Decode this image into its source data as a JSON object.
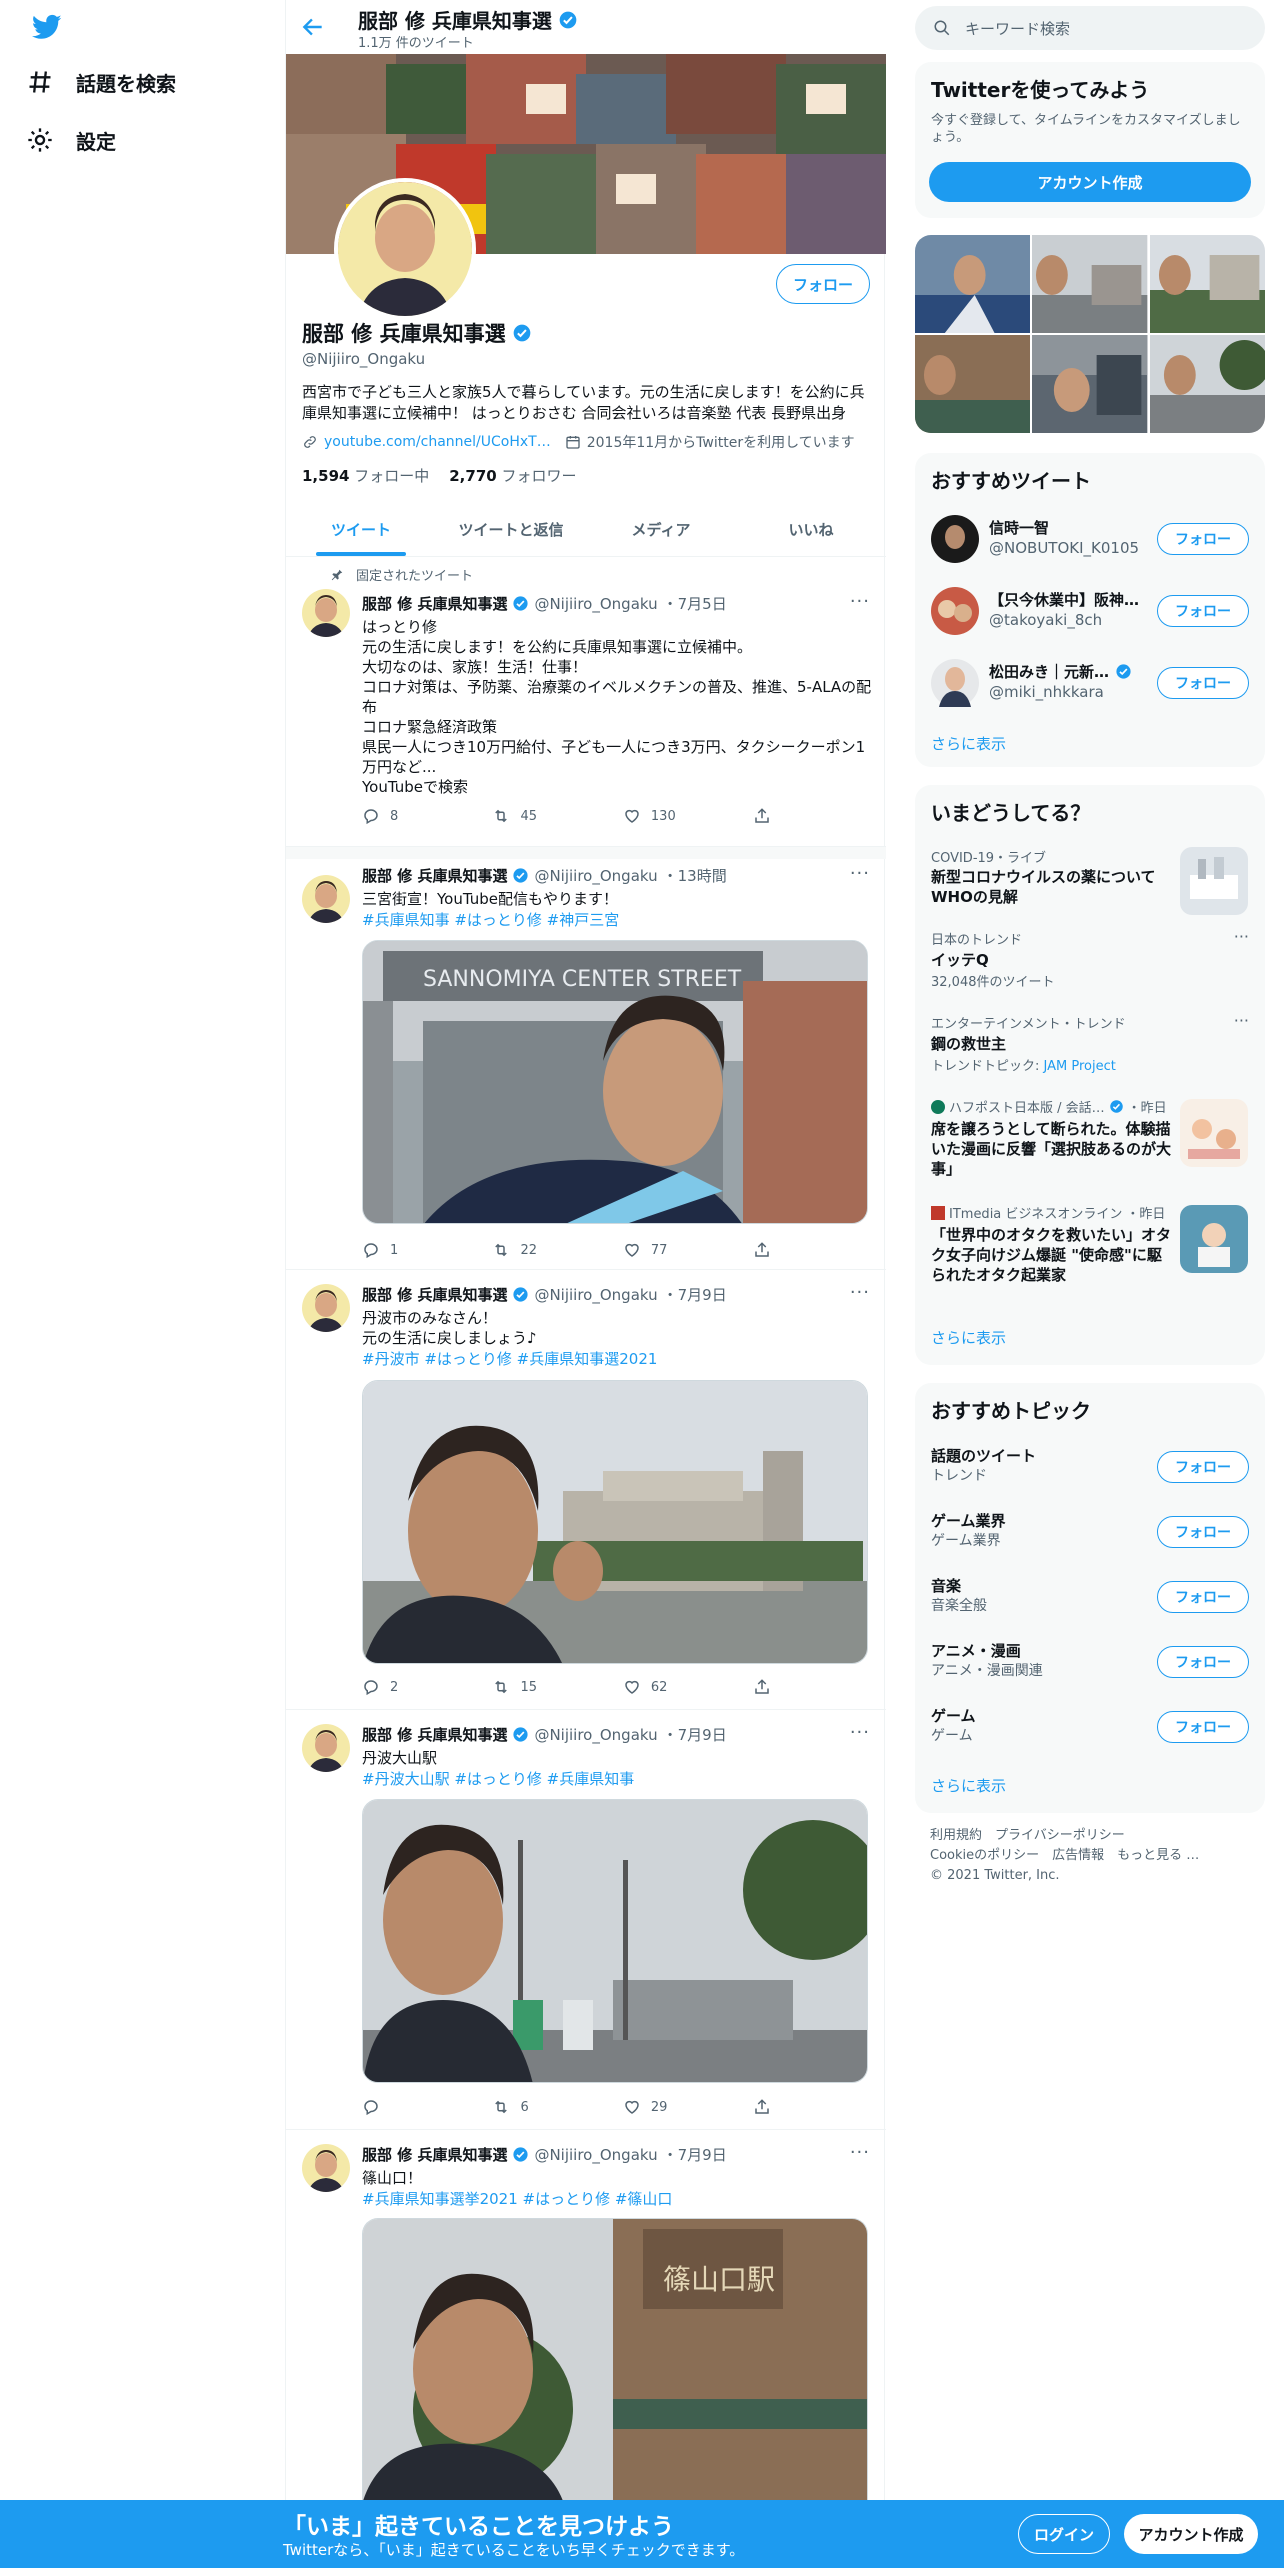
{
  "nav": {
    "explore": "話題を検索",
    "settings": "設定"
  },
  "header": {
    "title": "服部 修 兵庫県知事選",
    "subtitle": "1.1万 件のツイート"
  },
  "profile": {
    "name": "服部 修 兵庫県知事選",
    "handle": "@Nijiiro_Ongaku",
    "bio": "西宮市で子ども三人と家族5人で暮らしています。元の生活に戻します！を公約に兵庫県知事選に立候補中！ はっとりおさむ 合同会社いろは音楽塾 代表 長野県出身",
    "link": "youtube.com/channel/UCoHxT…",
    "joined": "2015年11月からTwitterを利用しています",
    "following_count": "1,594",
    "following_label": "フォロー中",
    "followers_count": "2,770",
    "followers_label": "フォロワー",
    "follow_button": "フォロー"
  },
  "tabs": [
    {
      "label": "ツイート"
    },
    {
      "label": "ツイートと返信"
    },
    {
      "label": "メディア"
    },
    {
      "label": "いいね"
    }
  ],
  "tweets": [
    {
      "pinned_label": "固定されたツイート",
      "name": "服部 修 兵庫県知事選",
      "handle": "@Nijiiro_Ongaku",
      "time": "・7月5日",
      "text": "はっとり修\n元の生活に戻します！を公約に兵庫県知事選に立候補中。\n大切なのは、家族！生活！仕事！\nコロナ対策は、予防薬、治療薬のイベルメクチンの普及、推進、5-ALAの配布\nコロナ緊急経済政策\n県民一人につき10万円給付、子ども一人につき3万円、タクシークーポン1万円など...\nYouTubeで検索",
      "tags": "",
      "replies": "8",
      "retweets": "45",
      "likes": "130"
    },
    {
      "name": "服部 修 兵庫県知事選",
      "handle": "@Nijiiro_Ongaku",
      "time": "・13時間",
      "text": "三宮街宣！YouTube配信もやります！",
      "tags": "#兵庫県知事 #はっとり修 #神戸三宮",
      "sign": "SANNOMIYA CENTER STREET",
      "replies": "1",
      "retweets": "22",
      "likes": "77"
    },
    {
      "name": "服部 修 兵庫県知事選",
      "handle": "@Nijiiro_Ongaku",
      "time": "・7月9日",
      "text": "丹波市のみなさん！\n元の生活に戻しましょう♪",
      "tags": "#丹波市 #はっとり修 #兵庫県知事選2021",
      "replies": "2",
      "retweets": "15",
      "likes": "62"
    },
    {
      "name": "服部 修 兵庫県知事選",
      "handle": "@Nijiiro_Ongaku",
      "time": "・7月9日",
      "text": "丹波大山駅",
      "tags": "#丹波大山駅 #はっとり修 #兵庫県知事",
      "replies": "",
      "retweets": "6",
      "likes": "29"
    },
    {
      "name": "服部 修 兵庫県知事選",
      "handle": "@Nijiiro_Ongaku",
      "time": "・7月9日",
      "text": "篠山口！",
      "tags": "#兵庫県知事選挙2021 #はっとり修 #篠山口",
      "sign": "篠山口駅"
    }
  ],
  "right": {
    "search_placeholder": "キーワード検索",
    "signup_card": {
      "title": "Twitterを使ってみよう",
      "desc": "今すぐ登録して、タイムラインをカスタマイズしましょう。",
      "button": "アカウント作成"
    },
    "who_to_follow": {
      "title": "おすすめツイート",
      "users": [
        {
          "name": "信時一智",
          "handle": "@NOBUTOKI_K0105",
          "verified": false
        },
        {
          "name": "【只今休業中】阪神…",
          "handle": "@takoyaki_8ch",
          "verified": false
        },
        {
          "name": "松田みき｜元新…",
          "handle": "@miki_nhkkara",
          "verified": true
        }
      ],
      "follow": "フォロー",
      "more": "さらに表示"
    },
    "trends": {
      "title": "いまどうしてる？",
      "items": [
        {
          "context": "COVID-19・ライブ",
          "title": "新型コロナウイルスの薬についてWHOの見解"
        },
        {
          "context": "日本のトレンド",
          "title": "イッテQ",
          "sub": "32,048件のツイート"
        },
        {
          "context": "エンターテインメント・トレンド",
          "title": "鋼の救世主",
          "sub_prefix": "トレンドトピック: ",
          "sub_link": "JAM Project"
        },
        {
          "context": "ハフポスト日本版 / 会話…",
          "context_time": "・昨日",
          "title": "席を譲ろうとして断られた。体験描いた漫画に反響「選択肢あるのが大事」"
        },
        {
          "context": "ITmedia ビジネスオンライン",
          "context_time": "・昨日",
          "title": "「世界中のオタクを救いたい」オタク女子向けジム爆誕 \"使命感\"に駆られたオタク起業家"
        }
      ],
      "more": "さらに表示"
    },
    "topics": {
      "title": "おすすめトピック",
      "items": [
        {
          "title": "話題のツイート",
          "sub": "トレンド"
        },
        {
          "title": "ゲーム業界",
          "sub": "ゲーム業界"
        },
        {
          "title": "音楽",
          "sub": "音楽全般"
        },
        {
          "title": "アニメ・漫画",
          "sub": "アニメ・漫画関連"
        },
        {
          "title": "ゲーム",
          "sub": "ゲーム"
        }
      ],
      "follow": "フォロー",
      "more": "さらに表示"
    },
    "footer": {
      "links1": "利用規約　プライバシーポリシー",
      "links2": "Cookieのポリシー　広告情報　もっと見る …",
      "copyright": "© 2021 Twitter, Inc."
    }
  },
  "bottom_bar": {
    "title": "「いま」起きていることを見つけよう",
    "subtitle": "Twitterなら、「いま」起きていることをいち早くチェックできます。",
    "login": "ログイン",
    "signup": "アカウント作成"
  }
}
